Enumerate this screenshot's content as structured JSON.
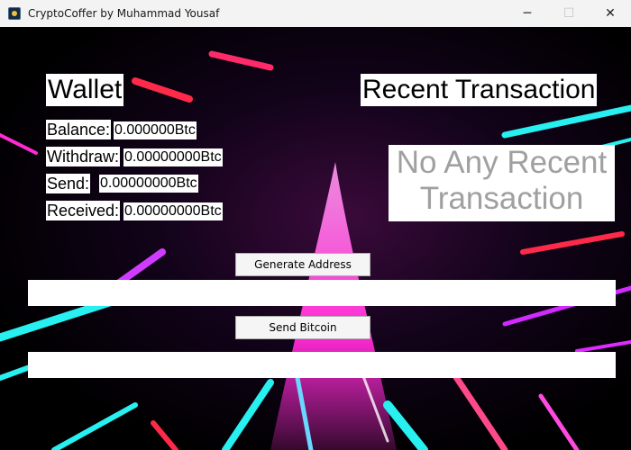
{
  "window": {
    "title": "CryptoCoffer by Muhammad Yousaf",
    "controls": {
      "minimize": "─",
      "maximize": "☐",
      "close": "✕"
    }
  },
  "wallet": {
    "heading": "Wallet",
    "balance_label": "Balance:",
    "balance_value": "0.000000Btc",
    "withdraw_label": "Withdraw:",
    "withdraw_value": "0.00000000Btc",
    "send_label": "Send:",
    "send_value": "0.00000000Btc",
    "received_label": "Received:",
    "received_value": "0.00000000Btc"
  },
  "recent": {
    "heading": "Recent Transaction",
    "empty_line1": "No Any Recent",
    "empty_line2": "Transaction"
  },
  "actions": {
    "generate_label": "Generate Address",
    "address_value": "",
    "send_label": "Send Bitcoin",
    "send_value": ""
  },
  "colors": {
    "titlebar": "#f3f3f3",
    "background": "#000000",
    "placeholder_text": "#a0a0a0",
    "neon_pink": "#ff2ad4",
    "neon_cyan": "#28f0f0",
    "neon_red": "#ff2a4a"
  },
  "icons": [
    "app-icon",
    "minimize-icon",
    "maximize-icon",
    "close-icon"
  ]
}
